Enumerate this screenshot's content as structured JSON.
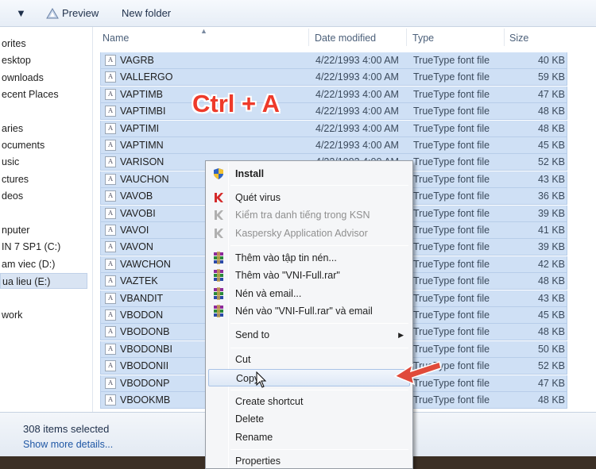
{
  "toolbar": {
    "organize_arrow": "▼",
    "preview_label": "Preview",
    "new_folder_label": "New folder"
  },
  "nav": {
    "items": [
      {
        "label": "orites"
      },
      {
        "label": "esktop"
      },
      {
        "label": "ownloads"
      },
      {
        "label": "ecent Places"
      },
      {
        "label": "aries"
      },
      {
        "label": "ocuments"
      },
      {
        "label": "usic"
      },
      {
        "label": "ctures"
      },
      {
        "label": "deos"
      },
      {
        "label": "nputer"
      },
      {
        "label": "IN 7 SP1 (C:)"
      },
      {
        "label": "am viec (D:)"
      },
      {
        "label": "ua lieu (E:)"
      },
      {
        "label": "work"
      }
    ]
  },
  "columns": {
    "name": "Name",
    "date": "Date modified",
    "type": "Type",
    "size": "Size"
  },
  "files": [
    {
      "name": "VAGRB",
      "date": "4/22/1993 4:00 AM",
      "type": "TrueType font file",
      "size": "40 KB"
    },
    {
      "name": "VALLERGO",
      "date": "4/22/1993 4:00 AM",
      "type": "TrueType font file",
      "size": "59 KB"
    },
    {
      "name": "VAPTIMB",
      "date": "4/22/1993 4:00 AM",
      "type": "TrueType font file",
      "size": "47 KB"
    },
    {
      "name": "VAPTIMBI",
      "date": "4/22/1993 4:00 AM",
      "type": "TrueType font file",
      "size": "48 KB"
    },
    {
      "name": "VAPTIMI",
      "date": "4/22/1993 4:00 AM",
      "type": "TrueType font file",
      "size": "48 KB"
    },
    {
      "name": "VAPTIMN",
      "date": "4/22/1993 4:00 AM",
      "type": "TrueType font file",
      "size": "45 KB"
    },
    {
      "name": "VARISON",
      "date": "4/22/1993 4:00 AM",
      "type": "TrueType font file",
      "size": "52 KB"
    },
    {
      "name": "VAUCHON",
      "date": "",
      "type": "TrueType font file",
      "size": "43 KB"
    },
    {
      "name": "VAVOB",
      "date": "",
      "type": "TrueType font file",
      "size": "36 KB"
    },
    {
      "name": "VAVOBI",
      "date": "",
      "type": "TrueType font file",
      "size": "39 KB"
    },
    {
      "name": "VAVOI",
      "date": "",
      "type": "TrueType font file",
      "size": "41 KB"
    },
    {
      "name": "VAVON",
      "date": "",
      "type": "TrueType font file",
      "size": "39 KB"
    },
    {
      "name": "VAWCHON",
      "date": "",
      "type": "TrueType font file",
      "size": "42 KB"
    },
    {
      "name": "VAZTEK",
      "date": "",
      "type": "TrueType font file",
      "size": "48 KB"
    },
    {
      "name": "VBANDIT",
      "date": "",
      "type": "TrueType font file",
      "size": "43 KB"
    },
    {
      "name": "VBODON",
      "date": "",
      "type": "TrueType font file",
      "size": "45 KB"
    },
    {
      "name": "VBODONB",
      "date": "",
      "type": "TrueType font file",
      "size": "48 KB"
    },
    {
      "name": "VBODONBI",
      "date": "",
      "type": "TrueType font file",
      "size": "50 KB"
    },
    {
      "name": "VBODONII",
      "date": "",
      "type": "TrueType font file",
      "size": "52 KB"
    },
    {
      "name": "VBODONP",
      "date": "",
      "type": "TrueType font file",
      "size": "47 KB"
    },
    {
      "name": "VBOOKMB",
      "date": "",
      "type": "TrueType font file",
      "size": "48 KB"
    }
  ],
  "annotation": "Ctrl + A",
  "context_menu": {
    "install": "Install",
    "quet_virus": "Quét virus",
    "kiem_tra": "Kiểm tra danh tiếng trong KSN",
    "kaspersky_advisor": "Kaspersky Application Advisor",
    "them_vao_tap_tin": "Thêm vào tập tin nén...",
    "them_vao_rar": "Thêm vào \"VNI-Full.rar\"",
    "nen_va_email": "Nén và email...",
    "nen_vao_rar_email": "Nén vào \"VNI-Full.rar\" và email",
    "send_to": "Send to",
    "cut": "Cut",
    "copy": "Copy",
    "create_shortcut": "Create shortcut",
    "delete": "Delete",
    "rename": "Rename",
    "properties": "Properties"
  },
  "details": {
    "selected": "308 items selected",
    "more": "Show more details..."
  },
  "colors": {
    "selection": "#cfe0f5",
    "annotation": "#ee3a2a",
    "link": "#1f57a5"
  }
}
